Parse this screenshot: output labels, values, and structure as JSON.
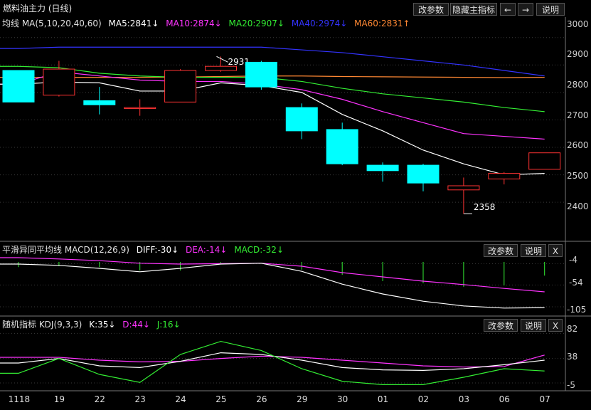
{
  "header": {
    "title": "燃料油主力 (日线)",
    "buttons": [
      "改参数",
      "隐藏主指标",
      "←",
      "→",
      "说明"
    ]
  },
  "ma_legend": {
    "prefix": "均线 MA(5,10,20,40,60)",
    "items": [
      {
        "text": "MA5:2841↓",
        "color": "#ffffff"
      },
      {
        "text": "MA10:2874↓",
        "color": "#ff33ff"
      },
      {
        "text": "MA20:2907↓",
        "color": "#33ee33"
      },
      {
        "text": "MA40:2974↓",
        "color": "#3333ff"
      },
      {
        "text": "MA60:2831↑",
        "color": "#ff8833"
      }
    ]
  },
  "macd_legend": {
    "prefix": "平滑异同平均线 MACD(12,26,9)",
    "items": [
      {
        "text": "DIFF:-30↓",
        "color": "#ffffff"
      },
      {
        "text": "DEA:-14↓",
        "color": "#ff33ff"
      },
      {
        "text": "MACD:-32↓",
        "color": "#33ee33"
      }
    ],
    "buttons": [
      "改参数",
      "说明",
      "X"
    ]
  },
  "kdj_legend": {
    "prefix": "随机指标 KDJ(9,3,3)",
    "items": [
      {
        "text": "K:35↓",
        "color": "#ffffff"
      },
      {
        "text": "D:44↓",
        "color": "#ff33ff"
      },
      {
        "text": "J:16↓",
        "color": "#33ee33"
      }
    ],
    "buttons": [
      "改参数",
      "说明",
      "X"
    ]
  },
  "price_axis": [
    "3000",
    "2900",
    "2800",
    "2700",
    "2600",
    "2500",
    "2400"
  ],
  "macd_axis": [
    "-4",
    "-54",
    "-105"
  ],
  "kdj_axis": [
    "82",
    "38",
    "-5"
  ],
  "annotations": {
    "high": "2931",
    "low": "2358"
  },
  "colors": {
    "up": "#ff3333",
    "down": "#00ffff",
    "grid": "#3a3a3a"
  },
  "chart_data": {
    "type": "candlestick",
    "dates": [
      "1118",
      "19",
      "22",
      "23",
      "24",
      "25",
      "26",
      "29",
      "30",
      "01",
      "02",
      "03",
      "06",
      "07"
    ],
    "candles": [
      {
        "o": 2880,
        "h": 2880,
        "l": 2765,
        "c": 2765
      },
      {
        "o": 2790,
        "h": 2915,
        "l": 2785,
        "c": 2885
      },
      {
        "o": 2770,
        "h": 2820,
        "l": 2720,
        "c": 2755
      },
      {
        "o": 2745,
        "h": 2775,
        "l": 2715,
        "c": 2745
      },
      {
        "o": 2765,
        "h": 2885,
        "l": 2765,
        "c": 2880
      },
      {
        "o": 2880,
        "h": 2931,
        "l": 2875,
        "c": 2895
      },
      {
        "o": 2910,
        "h": 2915,
        "l": 2810,
        "c": 2820
      },
      {
        "o": 2745,
        "h": 2760,
        "l": 2630,
        "c": 2660
      },
      {
        "o": 2665,
        "h": 2690,
        "l": 2535,
        "c": 2540
      },
      {
        "o": 2535,
        "h": 2545,
        "l": 2475,
        "c": 2515
      },
      {
        "o": 2535,
        "h": 2540,
        "l": 2440,
        "c": 2470
      },
      {
        "o": 2445,
        "h": 2490,
        "l": 2358,
        "c": 2460
      },
      {
        "o": 2485,
        "h": 2510,
        "l": 2465,
        "c": 2505
      },
      {
        "o": 2520,
        "h": 2580,
        "l": 2520,
        "c": 2580
      }
    ],
    "ma5": [
      2830,
      2838,
      2835,
      2805,
      2805,
      2835,
      2825,
      2800,
      2720,
      2660,
      2590,
      2540,
      2500,
      2505
    ],
    "ma10": [
      2830,
      2875,
      2860,
      2845,
      2840,
      2840,
      2830,
      2810,
      2775,
      2730,
      2690,
      2650,
      2640,
      2630
    ],
    "ma20": [
      2895,
      2890,
      2870,
      2860,
      2855,
      2855,
      2855,
      2840,
      2815,
      2795,
      2780,
      2765,
      2745,
      2730
    ],
    "ma40": [
      2960,
      2965,
      2965,
      2965,
      2965,
      2965,
      2965,
      2955,
      2945,
      2930,
      2915,
      2900,
      2880,
      2860
    ],
    "ma60": [
      2855,
      2855,
      2855,
      2855,
      2856,
      2858,
      2860,
      2860,
      2858,
      2857,
      2856,
      2855,
      2854,
      2855
    ],
    "price_range": [
      2320,
      3020
    ],
    "macd_range": [
      -120,
      5
    ],
    "diff": [
      -5,
      -8,
      -15,
      -23,
      -15,
      -5,
      -3,
      -22,
      -52,
      -75,
      -92,
      -103,
      -108,
      -107
    ],
    "dea": [
      10,
      7,
      3,
      -3,
      -5,
      -4,
      -3,
      -10,
      -25,
      -35,
      -45,
      -53,
      -62,
      -70
    ],
    "macd_hist": [
      -12,
      -10,
      -12,
      -20,
      -20,
      -2,
      0,
      -18,
      -30,
      -45,
      -50,
      -58,
      -55,
      -32
    ],
    "kdj_range": [
      -10,
      90
    ],
    "k": [
      30,
      38,
      25,
      22,
      33,
      48,
      45,
      35,
      22,
      18,
      17,
      20,
      27,
      35
    ],
    "d": [
      40,
      40,
      35,
      32,
      33,
      38,
      42,
      40,
      35,
      30,
      25,
      23,
      24,
      44
    ],
    "j": [
      12,
      38,
      10,
      -4,
      45,
      68,
      52,
      20,
      -2,
      -8,
      -8,
      5,
      20,
      16
    ]
  }
}
